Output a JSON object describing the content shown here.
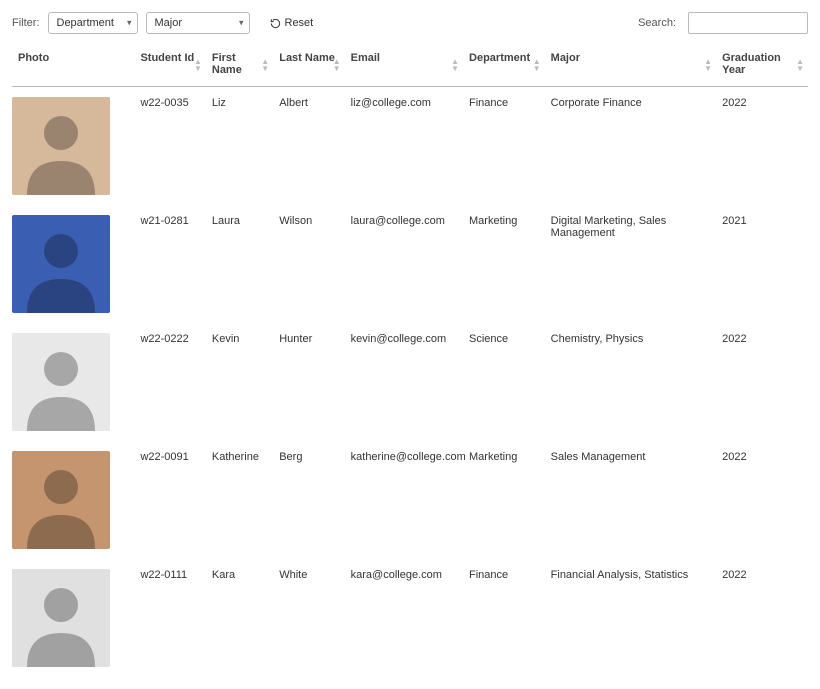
{
  "toolbar": {
    "filter_label": "Filter:",
    "department_select": "Department",
    "major_select": "Major",
    "reset_label": "Reset",
    "search_label": "Search:",
    "search_value": ""
  },
  "columns": {
    "photo": "Photo",
    "student_id": "Student Id",
    "first_name": "First Name",
    "last_name": "Last Name",
    "email": "Email",
    "department": "Department",
    "major": "Major",
    "graduation_year": "Graduation Year"
  },
  "rows": [
    {
      "student_id": "w22-0035",
      "first_name": "Liz",
      "last_name": "Albert",
      "email": "liz@college.com",
      "department": "Finance",
      "major": "Corporate Finance",
      "graduation_year": "2022"
    },
    {
      "student_id": "w21-0281",
      "first_name": "Laura",
      "last_name": "Wilson",
      "email": "laura@college.com",
      "department": "Marketing",
      "major": "Digital Marketing, Sales Management",
      "graduation_year": "2021"
    },
    {
      "student_id": "w22-0222",
      "first_name": "Kevin",
      "last_name": "Hunter",
      "email": "kevin@college.com",
      "department": "Science",
      "major": "Chemistry, Physics",
      "graduation_year": "2022"
    },
    {
      "student_id": "w22-0091",
      "first_name": "Katherine",
      "last_name": "Berg",
      "email": "katherine@college.com",
      "department": "Marketing",
      "major": "Sales Management",
      "graduation_year": "2022"
    },
    {
      "student_id": "w22-0111",
      "first_name": "Kara",
      "last_name": "White",
      "email": "kara@college.com",
      "department": "Finance",
      "major": "Financial Analysis, Statistics",
      "graduation_year": "2022"
    }
  ]
}
